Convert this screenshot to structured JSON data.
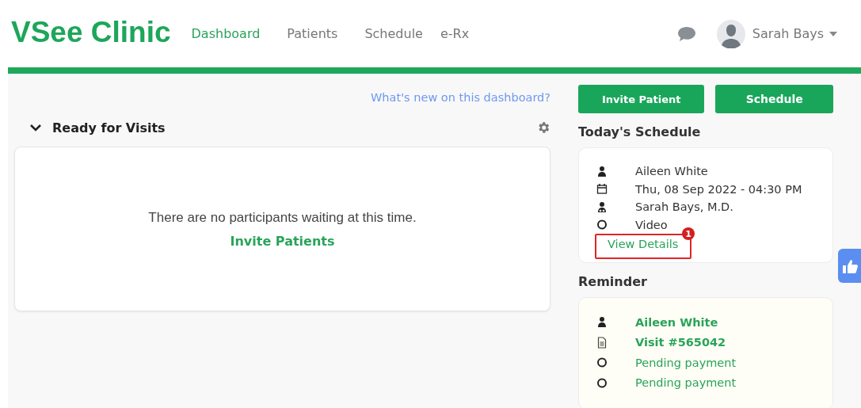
{
  "brand": "VSee Clinic",
  "nav": [
    {
      "label": "Dashboard",
      "selected": true
    },
    {
      "label": "Patients",
      "selected": false
    },
    {
      "label": "Schedule",
      "selected": false
    },
    {
      "label": "e-Rx",
      "selected": false
    }
  ],
  "user": {
    "name": "Sarah Bays"
  },
  "whats_new": "What's new on this dashboard?",
  "actions": [
    "Invite Patient",
    "Schedule"
  ],
  "ready": {
    "title": "Ready for Visits",
    "expanded": true,
    "empty_text": "There are no participants waiting at this time.",
    "link": "Invite Patients"
  },
  "today": {
    "title": "Today's Schedule",
    "items": [
      {
        "kind": "person",
        "text": "Aileen White"
      },
      {
        "kind": "calendar",
        "text": "Thu, 08 Sep 2022 - 04:30 PM"
      },
      {
        "kind": "doctor",
        "text": "Sarah Bays, M.D."
      },
      {
        "kind": "circle",
        "text": "Video"
      }
    ],
    "link": "View Details",
    "annotation": "1"
  },
  "reminder": {
    "title": "Reminder",
    "items": [
      {
        "kind": "person",
        "text": "Aileen White",
        "bold": true
      },
      {
        "kind": "document",
        "text": "Visit #565042",
        "bold": true
      },
      {
        "kind": "circle",
        "text": "Pending payment",
        "bold": false
      },
      {
        "kind": "circle",
        "text": "Pending payment",
        "bold": false
      }
    ]
  }
}
